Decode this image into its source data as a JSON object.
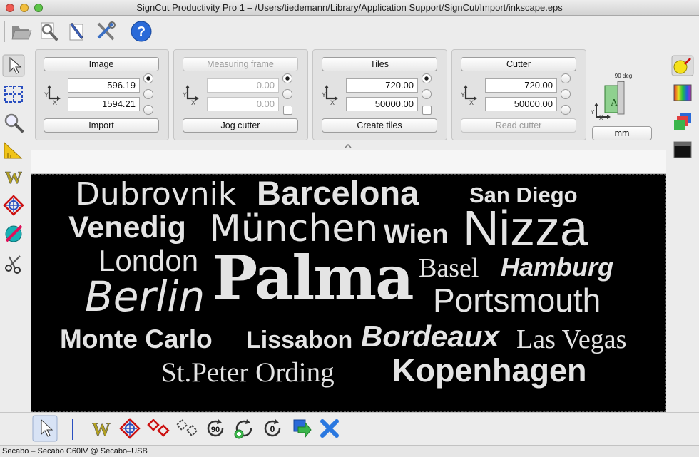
{
  "window": {
    "title": "SignCut Productivity Pro 1 – /Users/tiedemann/Library/Application Support/SignCut/Import/inkscape.eps"
  },
  "toolbar": {
    "icons": [
      "open-folder-icon",
      "find-icon",
      "edit-pen-icon",
      "tools-icon",
      "help-icon"
    ]
  },
  "panels": {
    "image": {
      "header": "Image",
      "x": "596.19",
      "y": "1594.21",
      "action": "Import",
      "enabled": true
    },
    "measuring_frame": {
      "header": "Measuring frame",
      "x": "0.00",
      "y": "0.00",
      "action": "Jog cutter",
      "enabled": false
    },
    "tiles": {
      "header": "Tiles",
      "x": "720.00",
      "y": "50000.00",
      "action": "Create tiles",
      "enabled": true
    },
    "cutter": {
      "header": "Cutter",
      "x": "720.00",
      "y": "50000.00",
      "action": "Read cutter",
      "enabled": true
    }
  },
  "axis_labels": {
    "x": "X",
    "y": "Y"
  },
  "rotation": {
    "label": "90 deg"
  },
  "units": {
    "label": "mm"
  },
  "canvas": {
    "words": [
      "Dubrovnik",
      "Barcelona",
      "San Diego",
      "Venedig",
      "München",
      "Wien",
      "Nizza",
      "London",
      "Palma",
      "Basel",
      "Hamburg",
      "Berlin",
      "Portsmouth",
      "Monte Carlo",
      "Lissabon",
      "Bordeaux",
      "Las Vegas",
      "St.Peter Ording",
      "Kopenhagen"
    ]
  },
  "bottom_tools": {
    "rotate_label": "90",
    "reset_label": "0"
  },
  "status": {
    "text": "Secabo – Secabo C60IV @ Secabo–USB"
  },
  "colors": {
    "canvas_bg": "#000000",
    "word": "#e4e4e4",
    "accent_red": "#cc1111",
    "help_blue": "#2a6ad8"
  }
}
